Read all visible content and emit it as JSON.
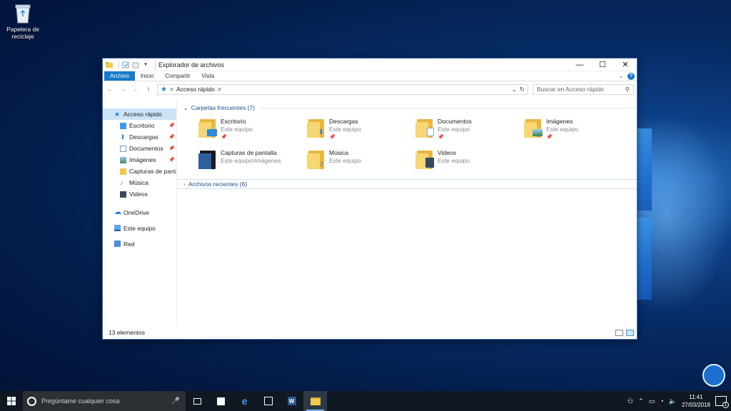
{
  "desktop": {
    "recycle_bin_label": "Papelera de reciclaje"
  },
  "window": {
    "title": "Explorador de archivos",
    "ribbon_tabs": [
      "Archivo",
      "Inicio",
      "Compartir",
      "Vista"
    ],
    "address": {
      "path": "Acceso rápido",
      "separator": ">"
    },
    "search_placeholder": "Buscar en Acceso rápido"
  },
  "nav_pane": {
    "quick_access": "Acceso rápido",
    "items": [
      {
        "label": "Escritorio",
        "icon": "desktop-icon",
        "pinned": true
      },
      {
        "label": "Descargas",
        "icon": "downloads-icon",
        "pinned": true
      },
      {
        "label": "Documentos",
        "icon": "documents-icon",
        "pinned": true
      },
      {
        "label": "Imágenes",
        "icon": "pictures-icon",
        "pinned": true
      },
      {
        "label": "Capturas de pantall",
        "icon": "folder-icon",
        "pinned": false
      },
      {
        "label": "Música",
        "icon": "music-icon",
        "pinned": false
      },
      {
        "label": "Videos",
        "icon": "videos-icon",
        "pinned": false
      }
    ],
    "onedrive": "OneDrive",
    "this_pc": "Este equipo",
    "network": "Red"
  },
  "content": {
    "frequent_header": "Carpetas frecuentes (7)",
    "folders": [
      {
        "name": "Escritorio",
        "location": "Este equipo",
        "pinned": true,
        "icon": "desktop-icon"
      },
      {
        "name": "Descargas",
        "location": "Este equipo",
        "pinned": true,
        "icon": "downloads-icon"
      },
      {
        "name": "Documentos",
        "location": "Este equipo",
        "pinned": true,
        "icon": "documents-icon"
      },
      {
        "name": "Imágenes",
        "location": "Este equipo",
        "pinned": true,
        "icon": "pictures-icon"
      },
      {
        "name": "Capturas de pantalla",
        "location": "Este equipo\\Imágenes",
        "pinned": false,
        "icon": "screenshots-icon"
      },
      {
        "name": "Música",
        "location": "Este equipo",
        "pinned": false,
        "icon": "music-icon"
      },
      {
        "name": "Videos",
        "location": "Este equipo",
        "pinned": false,
        "icon": "videos-icon"
      }
    ],
    "recent_header": "Archivos recientes (6)"
  },
  "status_bar": {
    "item_count": "13 elementos"
  },
  "taskbar": {
    "search_placeholder": "Pregúntame cualquier cosa",
    "time": "11:41",
    "date": "27/03/2018",
    "notification_count": "1"
  },
  "colors": {
    "accent": "#1979ca",
    "folder": "#f7d774",
    "taskbar": "#101821"
  }
}
